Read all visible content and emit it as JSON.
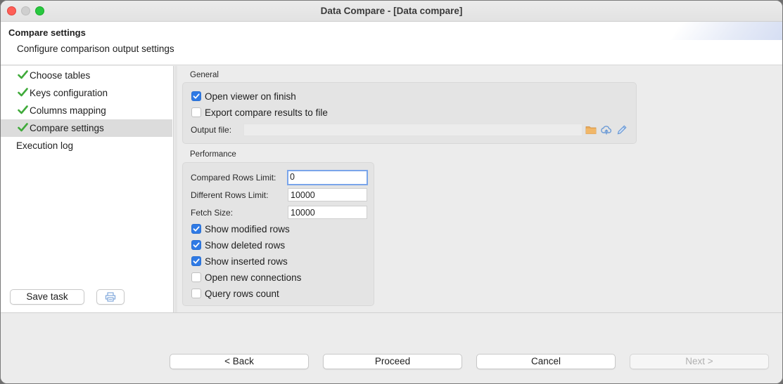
{
  "window": {
    "title": "Data Compare - [Data compare]"
  },
  "header": {
    "title": "Compare settings",
    "description": "Configure comparison output settings"
  },
  "sidebar": {
    "items": [
      {
        "label": "Choose tables",
        "completed": true,
        "selected": false
      },
      {
        "label": "Keys configuration",
        "completed": true,
        "selected": false
      },
      {
        "label": "Columns mapping",
        "completed": true,
        "selected": false
      },
      {
        "label": "Compare settings",
        "completed": true,
        "selected": true
      },
      {
        "label": "Execution log",
        "completed": false,
        "selected": false
      }
    ],
    "save_task_label": "Save task",
    "extra_icon": "printer-icon"
  },
  "general": {
    "label": "General",
    "open_viewer_label": "Open viewer on finish",
    "open_viewer_checked": true,
    "export_label": "Export compare results to file",
    "export_checked": false,
    "output_file_label": "Output file:",
    "output_file_value": "",
    "icons": [
      "folder-icon",
      "cloud-upload-icon",
      "pencil-icon"
    ]
  },
  "performance": {
    "label": "Performance",
    "compared_rows_limit_label": "Compared Rows Limit:",
    "compared_rows_limit_value": "0",
    "different_rows_limit_label": "Different Rows Limit:",
    "different_rows_limit_value": "10000",
    "fetch_size_label": "Fetch Size:",
    "fetch_size_value": "10000",
    "options": [
      {
        "label": "Show modified rows",
        "checked": true
      },
      {
        "label": "Show deleted rows",
        "checked": true
      },
      {
        "label": "Show inserted rows",
        "checked": true
      },
      {
        "label": "Open new connections",
        "checked": false
      },
      {
        "label": "Query rows count",
        "checked": false
      }
    ]
  },
  "footer": {
    "back_label": "< Back",
    "proceed_label": "Proceed",
    "cancel_label": "Cancel",
    "next_label": "Next >",
    "next_enabled": false
  },
  "colors": {
    "accent": "#2f7ae5",
    "check_green": "#3faa3a",
    "folder": "#e8a95a",
    "icon_blue": "#6b9ad6"
  }
}
